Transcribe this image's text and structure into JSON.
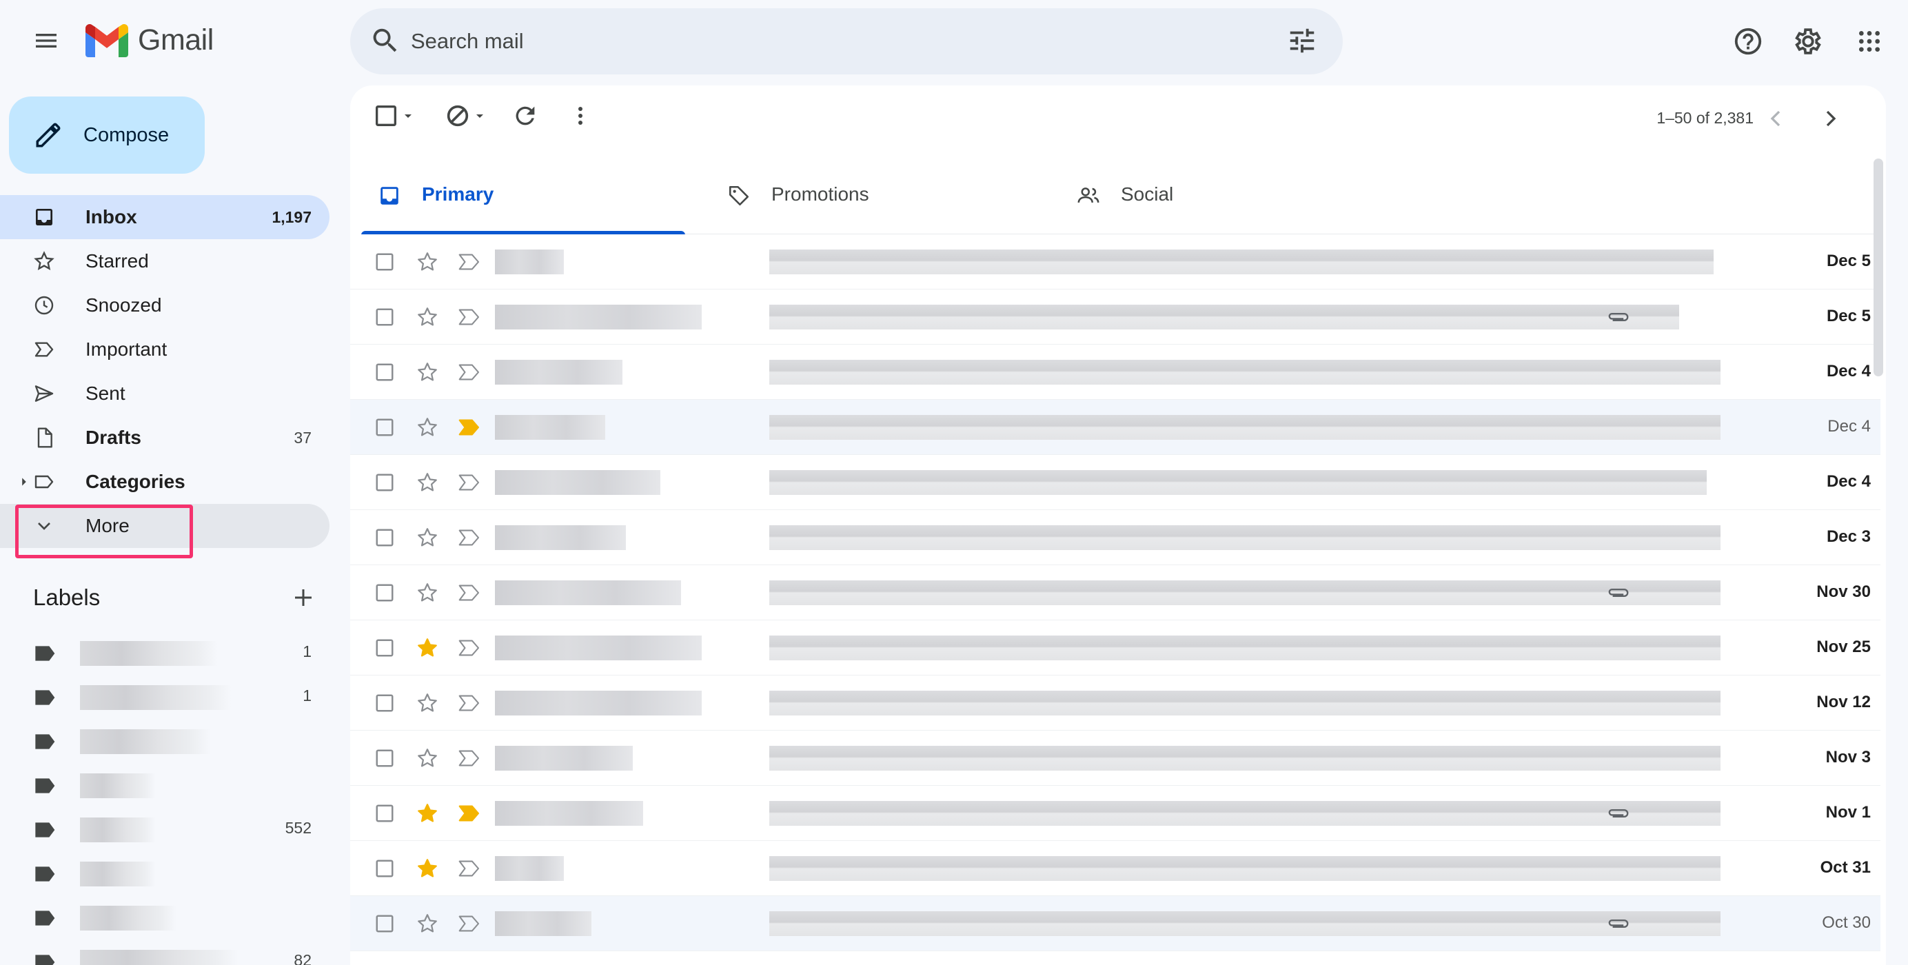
{
  "app": {
    "name": "Gmail"
  },
  "search": {
    "placeholder": "Search mail"
  },
  "compose": {
    "label": "Compose"
  },
  "nav": {
    "items": [
      {
        "label": "Inbox",
        "count": "1,197"
      },
      {
        "label": "Starred",
        "count": ""
      },
      {
        "label": "Snoozed",
        "count": ""
      },
      {
        "label": "Important",
        "count": ""
      },
      {
        "label": "Sent",
        "count": ""
      },
      {
        "label": "Drafts",
        "count": "37"
      },
      {
        "label": "Categories",
        "count": ""
      },
      {
        "label": "More",
        "count": ""
      }
    ]
  },
  "labels": {
    "title": "Labels",
    "items": [
      {
        "count": "1"
      },
      {
        "count": "1"
      },
      {
        "count": ""
      },
      {
        "count": ""
      },
      {
        "count": "552"
      },
      {
        "count": ""
      },
      {
        "count": ""
      },
      {
        "count": "82"
      }
    ]
  },
  "pager": {
    "range": "1–50 of 2,381"
  },
  "tabs": [
    {
      "label": "Primary"
    },
    {
      "label": "Promotions"
    },
    {
      "label": "Social"
    }
  ],
  "emails": [
    {
      "date": "Dec 5",
      "starred": false,
      "important": false,
      "attachment": false,
      "read": false
    },
    {
      "date": "Dec 5",
      "starred": false,
      "important": false,
      "attachment": true,
      "read": false
    },
    {
      "date": "Dec 4",
      "starred": false,
      "important": false,
      "attachment": false,
      "read": false
    },
    {
      "date": "Dec 4",
      "starred": false,
      "important": true,
      "attachment": false,
      "read": true
    },
    {
      "date": "Dec 4",
      "starred": false,
      "important": false,
      "attachment": false,
      "read": false
    },
    {
      "date": "Dec 3",
      "starred": false,
      "important": false,
      "attachment": false,
      "read": false
    },
    {
      "date": "Nov 30",
      "starred": false,
      "important": false,
      "attachment": true,
      "read": false
    },
    {
      "date": "Nov 25",
      "starred": true,
      "important": false,
      "attachment": false,
      "read": false
    },
    {
      "date": "Nov 12",
      "starred": false,
      "important": false,
      "attachment": false,
      "read": false
    },
    {
      "date": "Nov 3",
      "starred": false,
      "important": false,
      "attachment": false,
      "read": false
    },
    {
      "date": "Nov 1",
      "starred": true,
      "important": true,
      "attachment": true,
      "read": false
    },
    {
      "date": "Oct 31",
      "starred": true,
      "important": false,
      "attachment": false,
      "read": false
    },
    {
      "date": "Oct 30",
      "starred": false,
      "important": false,
      "attachment": true,
      "read": true
    }
  ],
  "colors": {
    "accent": "#0b57d0",
    "compose_bg": "#c2e7ff",
    "active_nav_bg": "#d3e3fd",
    "highlight_box": "#f5326e",
    "star": "#f4b400",
    "important_marker": "#f4b400",
    "page_bg": "#f6f8fc"
  },
  "icons": {
    "menu": "hamburger-icon",
    "search": "search-icon",
    "filter": "tune-icon",
    "help": "help-icon",
    "settings": "gear-icon",
    "apps": "apps-grid-icon"
  }
}
